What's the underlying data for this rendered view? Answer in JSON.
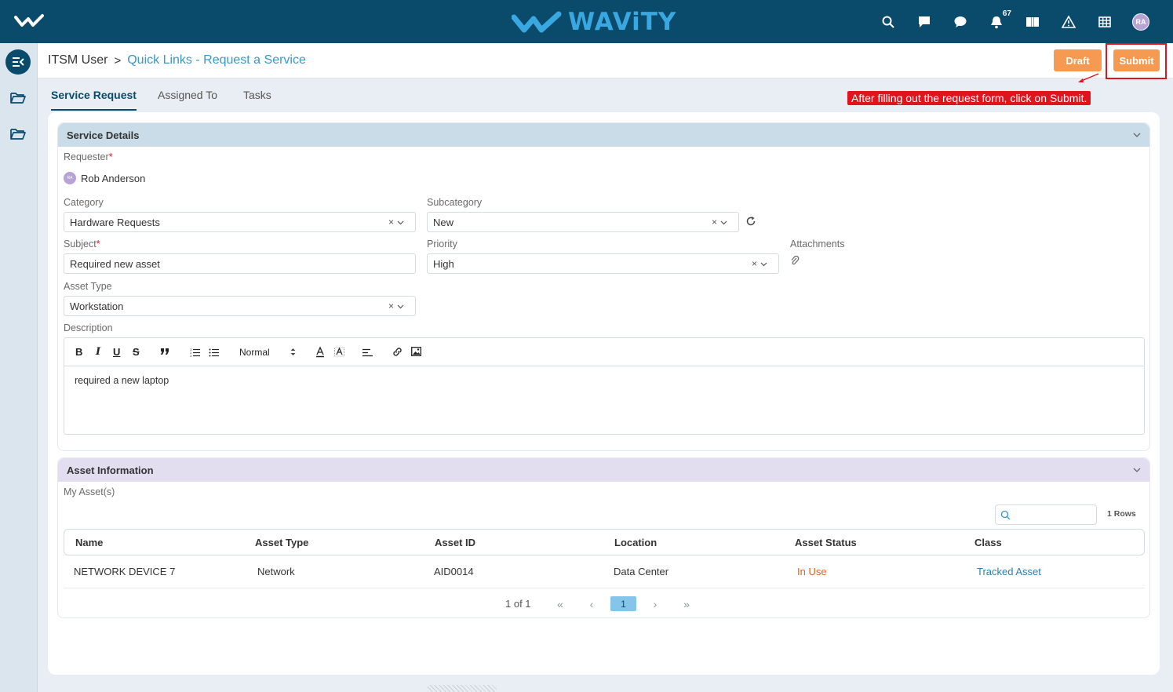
{
  "topbar": {
    "brand": "WAViTY",
    "notification_count": "67",
    "user_initials": "RA",
    "accent_color": "#0a4a6b",
    "icons": [
      "search-icon",
      "chat-square-icon",
      "chat-bubble-icon",
      "bell-icon",
      "book-icon",
      "warning-icon",
      "grid-icon"
    ]
  },
  "leftnav": {
    "items": [
      "menu-collapse-icon",
      "folder-icon",
      "folder-icon"
    ]
  },
  "header": {
    "crumb_root": "ITSM User",
    "crumb_separator": ">",
    "crumb_current": "Quick Links - Request a Service",
    "draft_label": "Draft",
    "submit_label": "Submit",
    "button_color": "#f59a50"
  },
  "tabs": [
    {
      "label": "Service Request",
      "active": true
    },
    {
      "label": "Assigned To",
      "active": false
    },
    {
      "label": "Tasks",
      "active": false
    }
  ],
  "annotation": "After filling out the request form, click on Submit.",
  "service_details": {
    "title": "Service Details",
    "requester_label": "Requester",
    "requester_name": "Rob Anderson",
    "requester_initials": "RA",
    "category_label": "Category",
    "category_value": "Hardware Requests",
    "subcategory_label": "Subcategory",
    "subcategory_value": "New",
    "subject_label": "Subject",
    "subject_value": "Required new asset",
    "priority_label": "Priority",
    "priority_value": "High",
    "attachments_label": "Attachments",
    "asset_type_label": "Asset Type",
    "asset_type_value": "Workstation",
    "description_label": "Description",
    "editor_format": "Normal",
    "description_text": "required a new laptop",
    "required_mark": "*",
    "clear_symbol": "×"
  },
  "asset_info": {
    "title": "Asset Information",
    "my_assets_label": "My Asset(s)",
    "search_placeholder": "",
    "rows_label": "1 Rows",
    "columns": [
      "Name",
      "Asset Type",
      "Asset ID",
      "Location",
      "Asset Status",
      "Class"
    ],
    "rows": [
      {
        "name": "NETWORK DEVICE 7",
        "asset_type": "Network",
        "asset_id": "AID0014",
        "location": "Data Center",
        "status": "In Use",
        "class": "Tracked Asset"
      }
    ],
    "pager": {
      "summary": "1 of 1",
      "first": "«",
      "prev": "‹",
      "current": "1",
      "next": "›",
      "last": "»"
    }
  }
}
